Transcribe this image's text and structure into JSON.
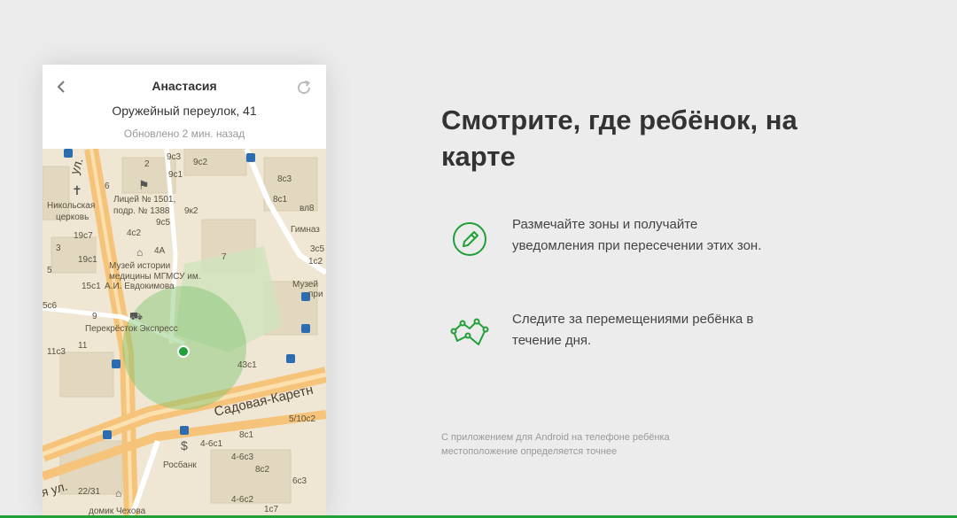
{
  "phone": {
    "header": {
      "name": "Анастасия",
      "address": "Оружейный переулок, 41",
      "updated": "Обновлено 2 мин. назад",
      "back_icon": "chevron-left-icon",
      "refresh_icon": "refresh-icon"
    },
    "map": {
      "street_main": "Садовая-Каретн",
      "street_left": "ул.",
      "street_bottom_left": "я ул.",
      "labels": [
        "9с3",
        "9с2",
        "9с1",
        "8с3",
        "Лицей № 1501,",
        "подр. № 1388",
        "9к2",
        "9с5",
        "Никольская",
        "церковь",
        "19с7",
        "4с2",
        "4А",
        "19с1",
        "Музей истории",
        "медицины МГМСУ им.",
        "15с1",
        "А.И. Евдокимова",
        "Гимназ",
        "8с1",
        "3с5",
        "Музей",
        "при",
        "5с6",
        "9",
        "Перекрёсток Экспресс",
        "11",
        "11с3",
        "43с1",
        "5/10с2",
        "8с1",
        "4-6с1",
        "Росбанк",
        "4-6с3",
        "8с2",
        "22/31",
        "домик Чехова",
        "4-6с2",
        "6с3",
        "1с7",
        "6",
        "7",
        "5",
        "вл8",
        "1с2",
        "2",
        "3"
      ]
    }
  },
  "headline": "Смотрите, где ребёнок, на карте",
  "features": [
    {
      "icon": "pencil-circle-icon",
      "text": "Размечайте зоны и получайте уведомления при пересечении этих зон."
    },
    {
      "icon": "route-path-icon",
      "text": "Следите за перемещениями ребёнка в течение дня."
    }
  ],
  "footnote": "С приложением для Android на телефоне ребёнка местоположение определяется точнее",
  "colors": {
    "accent": "#21a038",
    "zone_fill": "#7dc46c",
    "road_orange": "#f6c37a",
    "map_bg": "#efe7d4"
  }
}
